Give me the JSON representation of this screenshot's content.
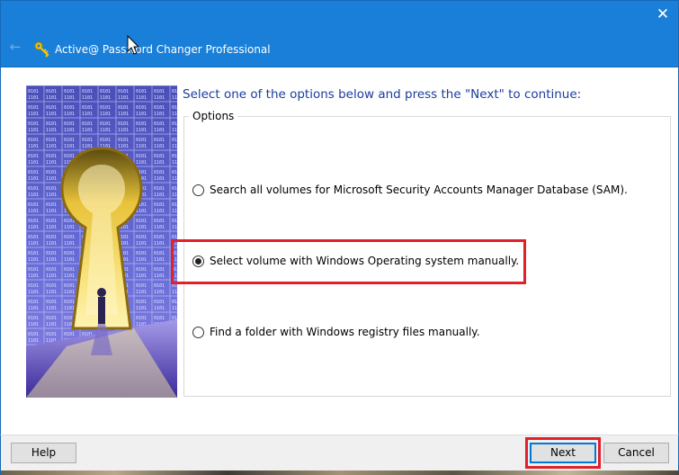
{
  "window": {
    "title": "Active@ Password Changer Professional",
    "close_icon": "close-icon",
    "back_icon": "back-arrow-icon",
    "app_icon": "keys-icon"
  },
  "main": {
    "instruction": "Select one of the options below and press the \"Next\" to continue:",
    "group_label": "Options",
    "options": [
      {
        "label": "Search all volumes for Microsoft Security Accounts Manager Database (SAM).",
        "checked": false
      },
      {
        "label": "Select volume with Windows Operating system manually.",
        "checked": true
      },
      {
        "label": "Find a folder with Windows registry files manually.",
        "checked": false
      }
    ],
    "highlight_color": "#e0202a"
  },
  "footer": {
    "help_label": "Help",
    "next_label": "Next",
    "cancel_label": "Cancel"
  },
  "colors": {
    "titlebar": "#1a7fd8",
    "instruction_text": "#1a3c9e",
    "footer_bg": "#f0f0f0"
  }
}
